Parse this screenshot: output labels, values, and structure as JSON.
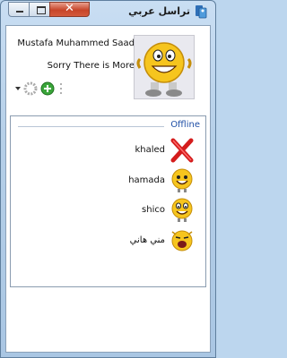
{
  "window": {
    "title": "تراسل عربي"
  },
  "titlebar": {
    "close_glyph": "✕"
  },
  "profile": {
    "name": "Mustafa Muhammed Saad",
    "status": "Sorry There is More"
  },
  "contacts": {
    "group_title": "Offline",
    "items": [
      {
        "name": "khaled",
        "icon": "red-x-icon"
      },
      {
        "name": "hamada",
        "icon": "smiley-emoticon-icon"
      },
      {
        "name": "shico",
        "icon": "smiley-emoticon-icon"
      },
      {
        "name": "مني هاني",
        "icon": "laughing-emoticon-icon"
      }
    ]
  },
  "colors": {
    "group_title": "#1f4fa6",
    "close_button": "#c7452a",
    "frame": "#bcd6ee"
  }
}
